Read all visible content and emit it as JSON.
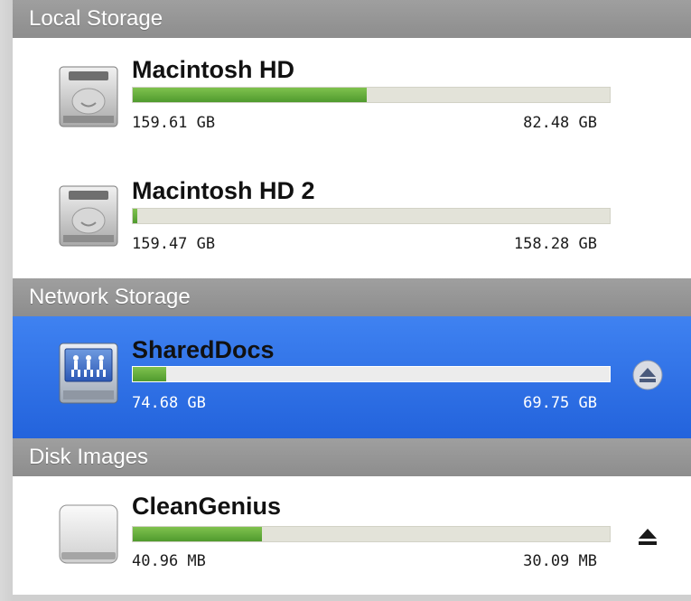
{
  "sections": {
    "local": {
      "title": "Local Storage",
      "items": [
        {
          "name": "Macintosh HD",
          "total": "159.61 GB",
          "free": "82.48 GB",
          "used_fraction": 0.49,
          "icon": "hard-drive-icon"
        },
        {
          "name": "Macintosh HD 2",
          "total": "159.47 GB",
          "free": "158.28 GB",
          "used_fraction": 0.01,
          "icon": "hard-drive-icon"
        }
      ]
    },
    "network": {
      "title": "Network Storage",
      "items": [
        {
          "name": "SharedDocs",
          "total": "74.68 GB",
          "free": "69.75 GB",
          "used_fraction": 0.07,
          "icon": "network-share-icon",
          "selected": true,
          "eject": true
        }
      ]
    },
    "images": {
      "title": "Disk Images",
      "items": [
        {
          "name": "CleanGenius",
          "total": "40.96 MB",
          "free": "30.09 MB",
          "used_fraction": 0.27,
          "icon": "disk-image-icon",
          "eject": true
        }
      ]
    }
  },
  "colors": {
    "header_bg": "#959595",
    "selection": "#2f6fe6",
    "bar_fill": "#5fae3a",
    "bar_track": "#e3e3d9"
  }
}
